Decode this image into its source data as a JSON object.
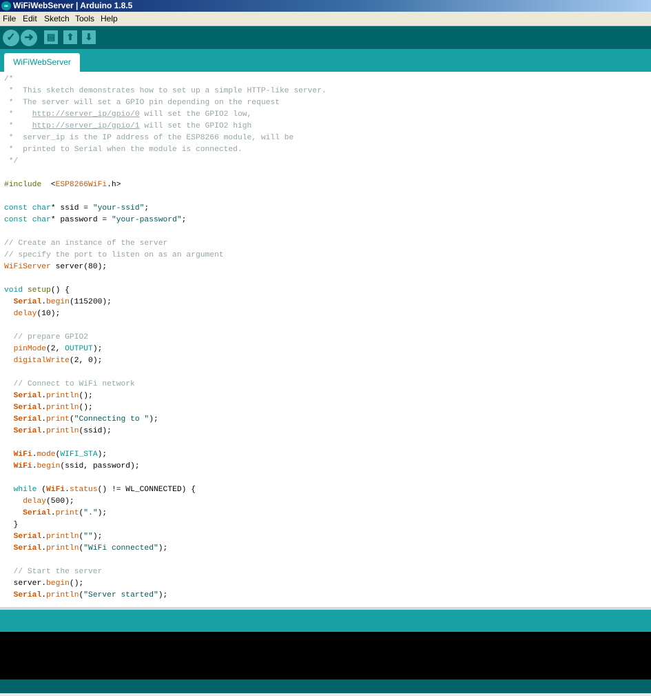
{
  "window": {
    "title": "WiFiWebServer | Arduino 1.8.5"
  },
  "menu": [
    "File",
    "Edit",
    "Sketch",
    "Tools",
    "Help"
  ],
  "toolbar": {
    "buttons": [
      {
        "name": "verify-button",
        "icon": "check-icon",
        "glyph": "✓"
      },
      {
        "name": "upload-button",
        "icon": "right-arrow-icon",
        "glyph": "➜"
      },
      {
        "name": "new-button",
        "icon": "new-file-icon",
        "glyph": "▤"
      },
      {
        "name": "open-button",
        "icon": "up-arrow-icon",
        "glyph": "⬆"
      },
      {
        "name": "save-button",
        "icon": "down-arrow-icon",
        "glyph": "⬇"
      }
    ]
  },
  "tab": {
    "label": "WiFiWebServer"
  },
  "colors": {
    "toolbar": "#006468",
    "tabbar": "#17a1a5",
    "console": "#000000",
    "comment": "#95a5a6",
    "keyword": "#00979c",
    "function": "#d35400"
  },
  "code": {
    "lines": [
      [
        [
          "cm",
          "/*"
        ]
      ],
      [
        [
          "cm",
          " *  This sketch demonstrates how to set up a simple HTTP-like server."
        ]
      ],
      [
        [
          "cm",
          " *  The server will set a GPIO pin depending on the request"
        ]
      ],
      [
        [
          "cm",
          " *    "
        ],
        [
          "url",
          "http://server_ip/gpio/0"
        ],
        [
          "cm",
          " will set the GPIO2 low,"
        ]
      ],
      [
        [
          "cm",
          " *    "
        ],
        [
          "url",
          "http://server_ip/gpio/1"
        ],
        [
          "cm",
          " will set the GPIO2 high"
        ]
      ],
      [
        [
          "cm",
          " *  server_ip is the IP address of the ESP8266 module, will be"
        ]
      ],
      [
        [
          "cm",
          " *  printed to Serial when the module is connected."
        ]
      ],
      [
        [
          "cm",
          " */"
        ]
      ],
      [],
      [
        [
          "pp",
          "#include"
        ],
        [
          "",
          "  <"
        ],
        [
          "fn",
          "ESP8266WiFi"
        ],
        [
          "",
          ".h>"
        ]
      ],
      [],
      [
        [
          "kw",
          "const"
        ],
        [
          "",
          " "
        ],
        [
          "kw",
          "char"
        ],
        [
          "",
          "* ssid = "
        ],
        [
          "st",
          "\"your-ssid\""
        ],
        [
          "",
          ";"
        ]
      ],
      [
        [
          "kw",
          "const"
        ],
        [
          "",
          " "
        ],
        [
          "kw",
          "char"
        ],
        [
          "",
          "* password = "
        ],
        [
          "st",
          "\"your-password\""
        ],
        [
          "",
          ";"
        ]
      ],
      [],
      [
        [
          "cm",
          "// Create an instance of the server"
        ]
      ],
      [
        [
          "cm",
          "// specify the port to listen on as an argument"
        ]
      ],
      [
        [
          "fn",
          "WiFiServer"
        ],
        [
          "",
          " server(80);"
        ]
      ],
      [],
      [
        [
          "kw",
          "void"
        ],
        [
          "",
          " "
        ],
        [
          "pp",
          "setup"
        ],
        [
          "",
          "() {"
        ]
      ],
      [
        [
          "",
          "  "
        ],
        [
          "obj",
          "Serial"
        ],
        [
          "",
          "."
        ],
        [
          "fn",
          "begin"
        ],
        [
          "",
          "(115200);"
        ]
      ],
      [
        [
          "",
          "  "
        ],
        [
          "fn",
          "delay"
        ],
        [
          "",
          "(10);"
        ]
      ],
      [],
      [
        [
          "cm",
          "  // prepare GPIO2"
        ]
      ],
      [
        [
          "",
          "  "
        ],
        [
          "fn",
          "pinMode"
        ],
        [
          "",
          "(2, "
        ],
        [
          "kw",
          "OUTPUT"
        ],
        [
          "",
          ");"
        ]
      ],
      [
        [
          "",
          "  "
        ],
        [
          "fn",
          "digitalWrite"
        ],
        [
          "",
          "(2, 0);"
        ]
      ],
      [],
      [
        [
          "cm",
          "  // Connect to WiFi network"
        ]
      ],
      [
        [
          "",
          "  "
        ],
        [
          "obj",
          "Serial"
        ],
        [
          "",
          "."
        ],
        [
          "fn",
          "println"
        ],
        [
          "",
          "();"
        ]
      ],
      [
        [
          "",
          "  "
        ],
        [
          "obj",
          "Serial"
        ],
        [
          "",
          "."
        ],
        [
          "fn",
          "println"
        ],
        [
          "",
          "();"
        ]
      ],
      [
        [
          "",
          "  "
        ],
        [
          "obj",
          "Serial"
        ],
        [
          "",
          "."
        ],
        [
          "fn",
          "print"
        ],
        [
          "",
          "("
        ],
        [
          "st",
          "\"Connecting to \""
        ],
        [
          "",
          ");"
        ]
      ],
      [
        [
          "",
          "  "
        ],
        [
          "obj",
          "Serial"
        ],
        [
          "",
          "."
        ],
        [
          "fn",
          "println"
        ],
        [
          "",
          "(ssid);"
        ]
      ],
      [],
      [
        [
          "",
          "  "
        ],
        [
          "obj",
          "WiFi"
        ],
        [
          "",
          "."
        ],
        [
          "fn",
          "mode"
        ],
        [
          "",
          "("
        ],
        [
          "kw",
          "WIFI_STA"
        ],
        [
          "",
          ");"
        ]
      ],
      [
        [
          "",
          "  "
        ],
        [
          "obj",
          "WiFi"
        ],
        [
          "",
          "."
        ],
        [
          "fn",
          "begin"
        ],
        [
          "",
          "(ssid, password);"
        ]
      ],
      [],
      [
        [
          "",
          "  "
        ],
        [
          "kw",
          "while"
        ],
        [
          "",
          " ("
        ],
        [
          "obj",
          "WiFi"
        ],
        [
          "",
          "."
        ],
        [
          "fn",
          "status"
        ],
        [
          "",
          "() != WL_CONNECTED) {"
        ]
      ],
      [
        [
          "",
          "    "
        ],
        [
          "fn",
          "delay"
        ],
        [
          "",
          "(500);"
        ]
      ],
      [
        [
          "",
          "    "
        ],
        [
          "obj",
          "Serial"
        ],
        [
          "",
          "."
        ],
        [
          "fn",
          "print"
        ],
        [
          "",
          "("
        ],
        [
          "st",
          "\".\""
        ],
        [
          "",
          ");"
        ]
      ],
      [
        [
          "",
          "  }"
        ]
      ],
      [
        [
          "",
          "  "
        ],
        [
          "obj",
          "Serial"
        ],
        [
          "",
          "."
        ],
        [
          "fn",
          "println"
        ],
        [
          "",
          "("
        ],
        [
          "st",
          "\"\""
        ],
        [
          "",
          ");"
        ]
      ],
      [
        [
          "",
          "  "
        ],
        [
          "obj",
          "Serial"
        ],
        [
          "",
          "."
        ],
        [
          "fn",
          "println"
        ],
        [
          "",
          "("
        ],
        [
          "st",
          "\"WiFi connected\""
        ],
        [
          "",
          ");"
        ]
      ],
      [],
      [
        [
          "cm",
          "  // Start the server"
        ]
      ],
      [
        [
          "",
          "  server."
        ],
        [
          "fn",
          "begin"
        ],
        [
          "",
          "();"
        ]
      ],
      [
        [
          "",
          "  "
        ],
        [
          "obj",
          "Serial"
        ],
        [
          "",
          "."
        ],
        [
          "fn",
          "println"
        ],
        [
          "",
          "("
        ],
        [
          "st",
          "\"Server started\""
        ],
        [
          "",
          ");"
        ]
      ]
    ]
  }
}
